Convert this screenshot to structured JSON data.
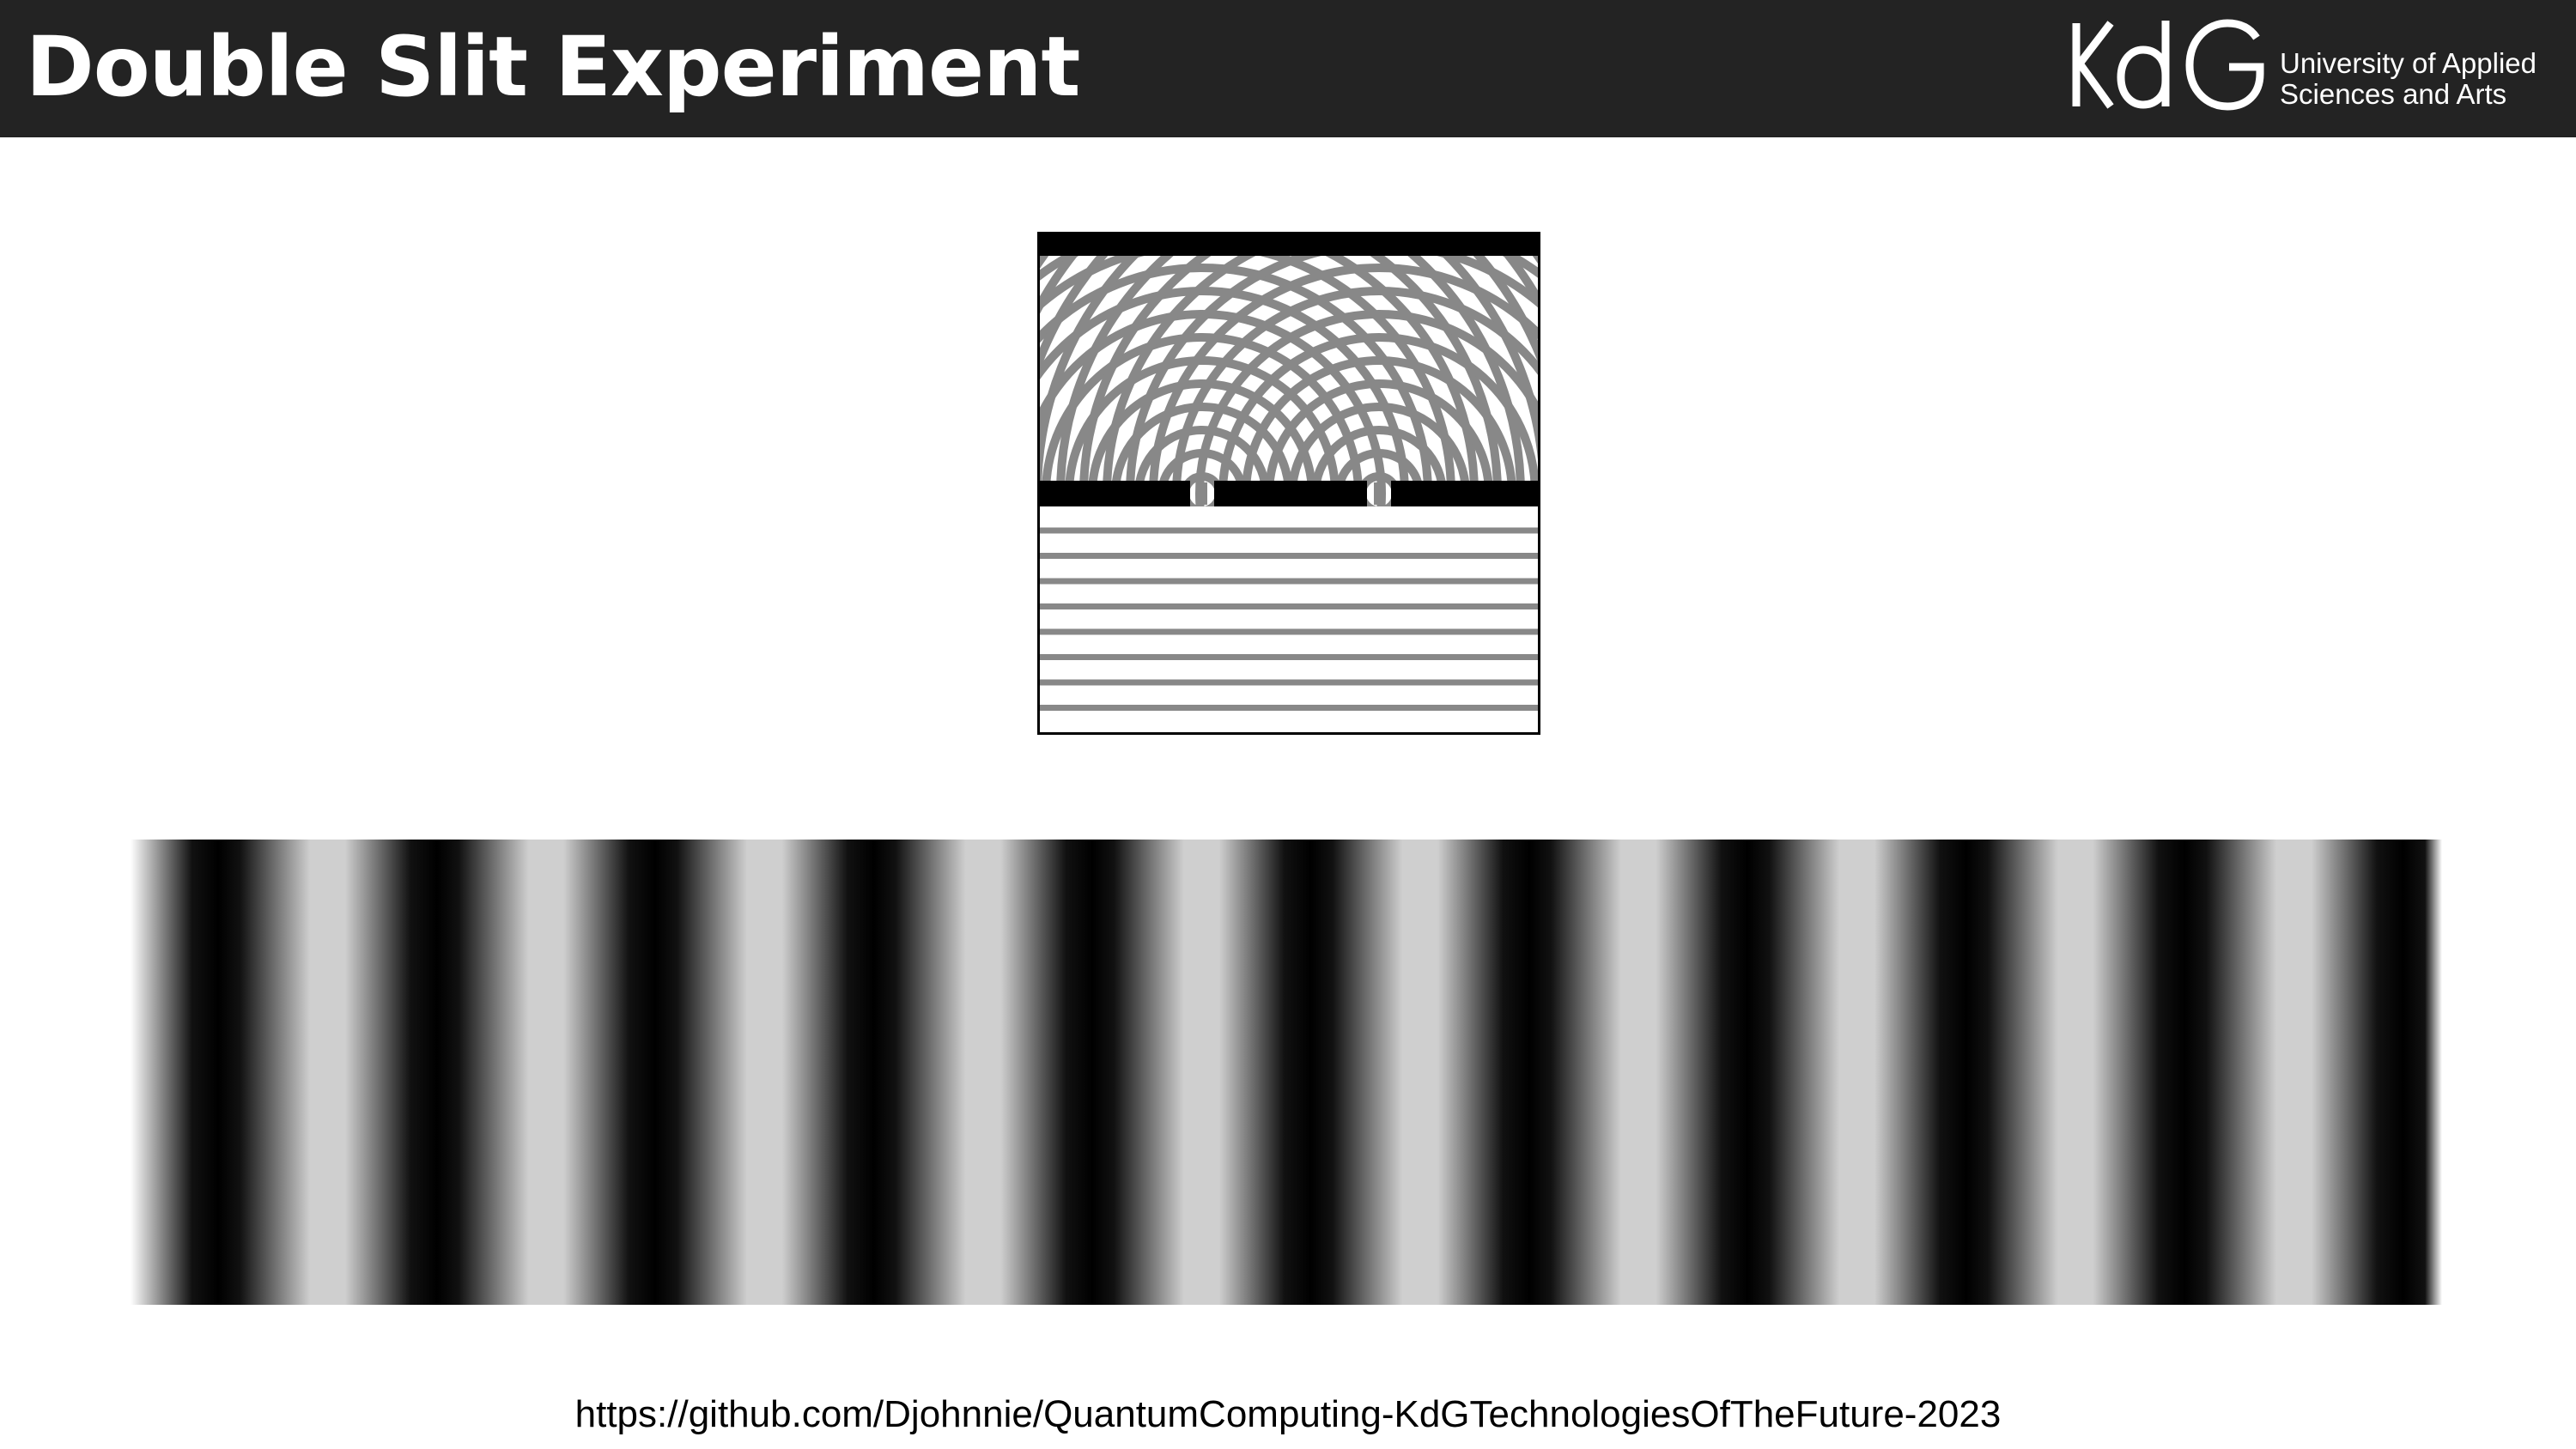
{
  "header": {
    "title": "Double Slit Experiment",
    "background_color": "#232323"
  },
  "logo": {
    "mark": "KdG",
    "line1": "University of Applied",
    "line2": "Sciences and Arts",
    "icon": "kdg-logo-icon"
  },
  "diagram": {
    "icon": "double-slit-wave-diagram",
    "slit_count": 2,
    "incoming_wave": "plane",
    "outgoing_wave": "circular-interference"
  },
  "fringe_pattern": {
    "icon": "interference-fringes",
    "dark_fringes": 11,
    "colors": {
      "dark": "#000000",
      "light": "#cfcfcf",
      "edge": "#ffffff"
    }
  },
  "footer": {
    "url": "https://github.com/Djohnnie/QuantumComputing-KdGTechnologiesOfTheFuture-2023"
  }
}
